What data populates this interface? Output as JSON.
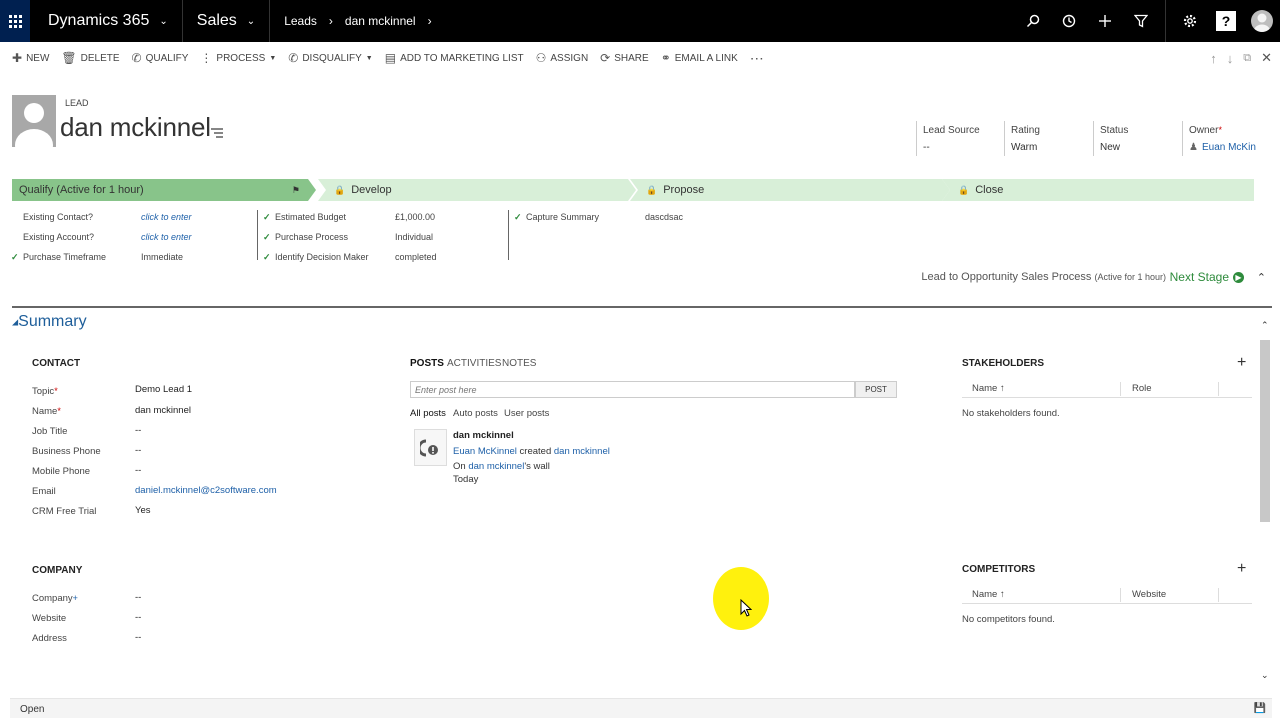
{
  "topnav": {
    "brand": "Dynamics 365",
    "module": "Sales",
    "breadcrumb": [
      "Leads",
      "dan mckinnel"
    ]
  },
  "commands": [
    "NEW",
    "DELETE",
    "QUALIFY",
    "PROCESS",
    "DISQUALIFY",
    "ADD TO MARKETING LIST",
    "ASSIGN",
    "SHARE",
    "EMAIL A LINK"
  ],
  "header": {
    "type_label": "LEAD",
    "name": "dan mckinnel",
    "fields": [
      {
        "label": "Lead Source",
        "value": "--"
      },
      {
        "label": "Rating",
        "value": "Warm"
      },
      {
        "label": "Status",
        "value": "New"
      },
      {
        "label": "Owner",
        "value": "Euan McKinnel"
      }
    ]
  },
  "process": {
    "stages": [
      "Qualify (Active for 1 hour)",
      "Develop",
      "Propose",
      "Close"
    ],
    "qualify_fields": [
      {
        "label": "Existing Contact?",
        "value": "click to enter",
        "done": false
      },
      {
        "label": "Existing Account?",
        "value": "click to enter",
        "done": false
      },
      {
        "label": "Purchase Timeframe",
        "value": "Immediate",
        "done": true
      }
    ],
    "mid_fields": [
      {
        "label": "Estimated Budget",
        "value": "£1,000.00"
      },
      {
        "label": "Purchase Process",
        "value": "Individual"
      },
      {
        "label": "Identify Decision Maker",
        "value": "completed"
      }
    ],
    "right_fields": [
      {
        "label": "Capture Summary",
        "value": "dascdsac"
      }
    ],
    "process_name": "Lead to Opportunity Sales Process",
    "process_active": "(Active for 1 hour)",
    "next_stage": "Next Stage"
  },
  "summary": {
    "title": "Summary",
    "contact_title": "CONTACT",
    "contact": [
      {
        "label": "Topic",
        "value": "Demo Lead 1"
      },
      {
        "label": "Name",
        "value": "dan mckinnel"
      },
      {
        "label": "Job Title",
        "value": "--"
      },
      {
        "label": "Business Phone",
        "value": "--"
      },
      {
        "label": "Mobile Phone",
        "value": "--"
      },
      {
        "label": "Email",
        "value": "daniel.mckinnel@c2software.com"
      },
      {
        "label": "CRM Free Trial",
        "value": "Yes"
      }
    ],
    "company_title": "COMPANY",
    "company": [
      {
        "label": "Company",
        "value": "--"
      },
      {
        "label": "Website",
        "value": "--"
      },
      {
        "label": "Address",
        "value": "--"
      }
    ]
  },
  "posts": {
    "tabs": [
      "POSTS",
      "ACTIVITIES",
      "NOTES"
    ],
    "placeholder": "Enter post here",
    "post_button": "POST",
    "subtabs": [
      "All posts",
      "Auto posts",
      "User posts"
    ],
    "entry": {
      "author": "dan mckinnel",
      "actor": "Euan McKinnel",
      "verb": "created",
      "target": "dan mckinnel",
      "on_prefix": "On",
      "wall_owner": "dan mckinnel",
      "wall_suffix": "'s wall",
      "time": "Today"
    }
  },
  "stakeholders": {
    "title": "STAKEHOLDERS",
    "col_name": "Name ↑",
    "col_role": "Role",
    "empty": "No stakeholders found."
  },
  "competitors": {
    "title": "COMPETITORS",
    "col_name": "Name ↑",
    "col_website": "Website",
    "empty": "No competitors found."
  },
  "status_bar": {
    "status": "Open"
  }
}
